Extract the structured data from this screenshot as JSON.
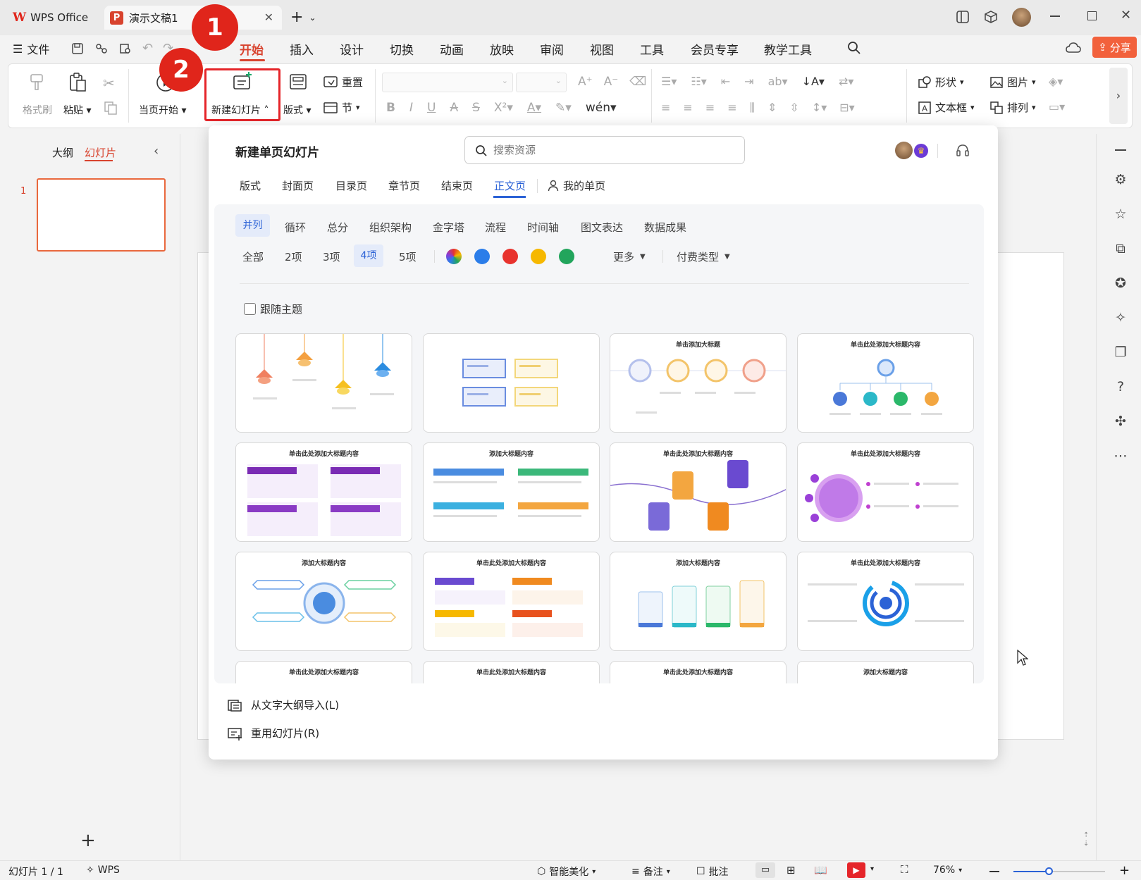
{
  "titlebar": {
    "app_tab": "WPS Office",
    "doc_tab": "演示文稿1",
    "new_tab": "+",
    "annotation_1": "1",
    "annotation_2": "2"
  },
  "menubar": {
    "file": "文件",
    "items": [
      "开始",
      "插入",
      "设计",
      "切换",
      "动画",
      "放映",
      "审阅",
      "视图",
      "工具",
      "会员专享",
      "教学工具"
    ],
    "share": "分享"
  },
  "ribbon": {
    "format_painter": "格式刷",
    "paste": "粘贴",
    "from_current": "当页开始",
    "new_slide": "新建幻灯片",
    "layout": "版式",
    "reset": "重置",
    "section": "节",
    "shape": "形状",
    "picture": "图片",
    "textbox": "文本框",
    "arrange": "排列"
  },
  "left_panel": {
    "outline_tab": "大纲",
    "slides_tab": "幻灯片",
    "slide_number": "1",
    "add": "+"
  },
  "panel": {
    "title": "新建单页幻灯片",
    "search_placeholder": "搜索资源",
    "tabs": [
      "版式",
      "封面页",
      "目录页",
      "章节页",
      "结束页",
      "正文页",
      "我的单页"
    ],
    "active_tab": "正文页",
    "subcategories": [
      "并列",
      "循环",
      "总分",
      "组织架构",
      "金字塔",
      "流程",
      "时间轴",
      "图文表达",
      "数据成果"
    ],
    "counts": [
      "全部",
      "2项",
      "3项",
      "4项",
      "5项"
    ],
    "color_filters": [
      "#2b7de9",
      "#e8332e",
      "#f6b800",
      "#22a55c"
    ],
    "more": "更多",
    "pay_type": "付费类型",
    "follow_theme": "跟随主题",
    "cards": [
      {
        "title": ""
      },
      {
        "title": ""
      },
      {
        "title": "单击添加大标题"
      },
      {
        "title": "单击此处添加大标题内容"
      },
      {
        "title": "单击此处添加大标题内容"
      },
      {
        "title": "添加大标题内容"
      },
      {
        "title": "单击此处添加大标题内容"
      },
      {
        "title": "单击此处添加大标题内容"
      },
      {
        "title": "添加大标题内容"
      },
      {
        "title": "单击此处添加大标题内容"
      },
      {
        "title": "添加大标题内容"
      },
      {
        "title": "单击此处添加大标题内容"
      },
      {
        "title": "单击此处添加大标题内容"
      },
      {
        "title": "单击此处添加大标题内容"
      },
      {
        "title": "单击此处添加大标题内容"
      },
      {
        "title": "添加大标题内容"
      }
    ],
    "import_outline": "从文字大纲导入(L)",
    "reuse_slides": "重用幻灯片(R)"
  },
  "statusbar": {
    "slide_count": "幻灯片 1 / 1",
    "wps": "WPS",
    "beautify": "智能美化",
    "notes": "备注",
    "comments": "批注",
    "zoom": "76%"
  }
}
